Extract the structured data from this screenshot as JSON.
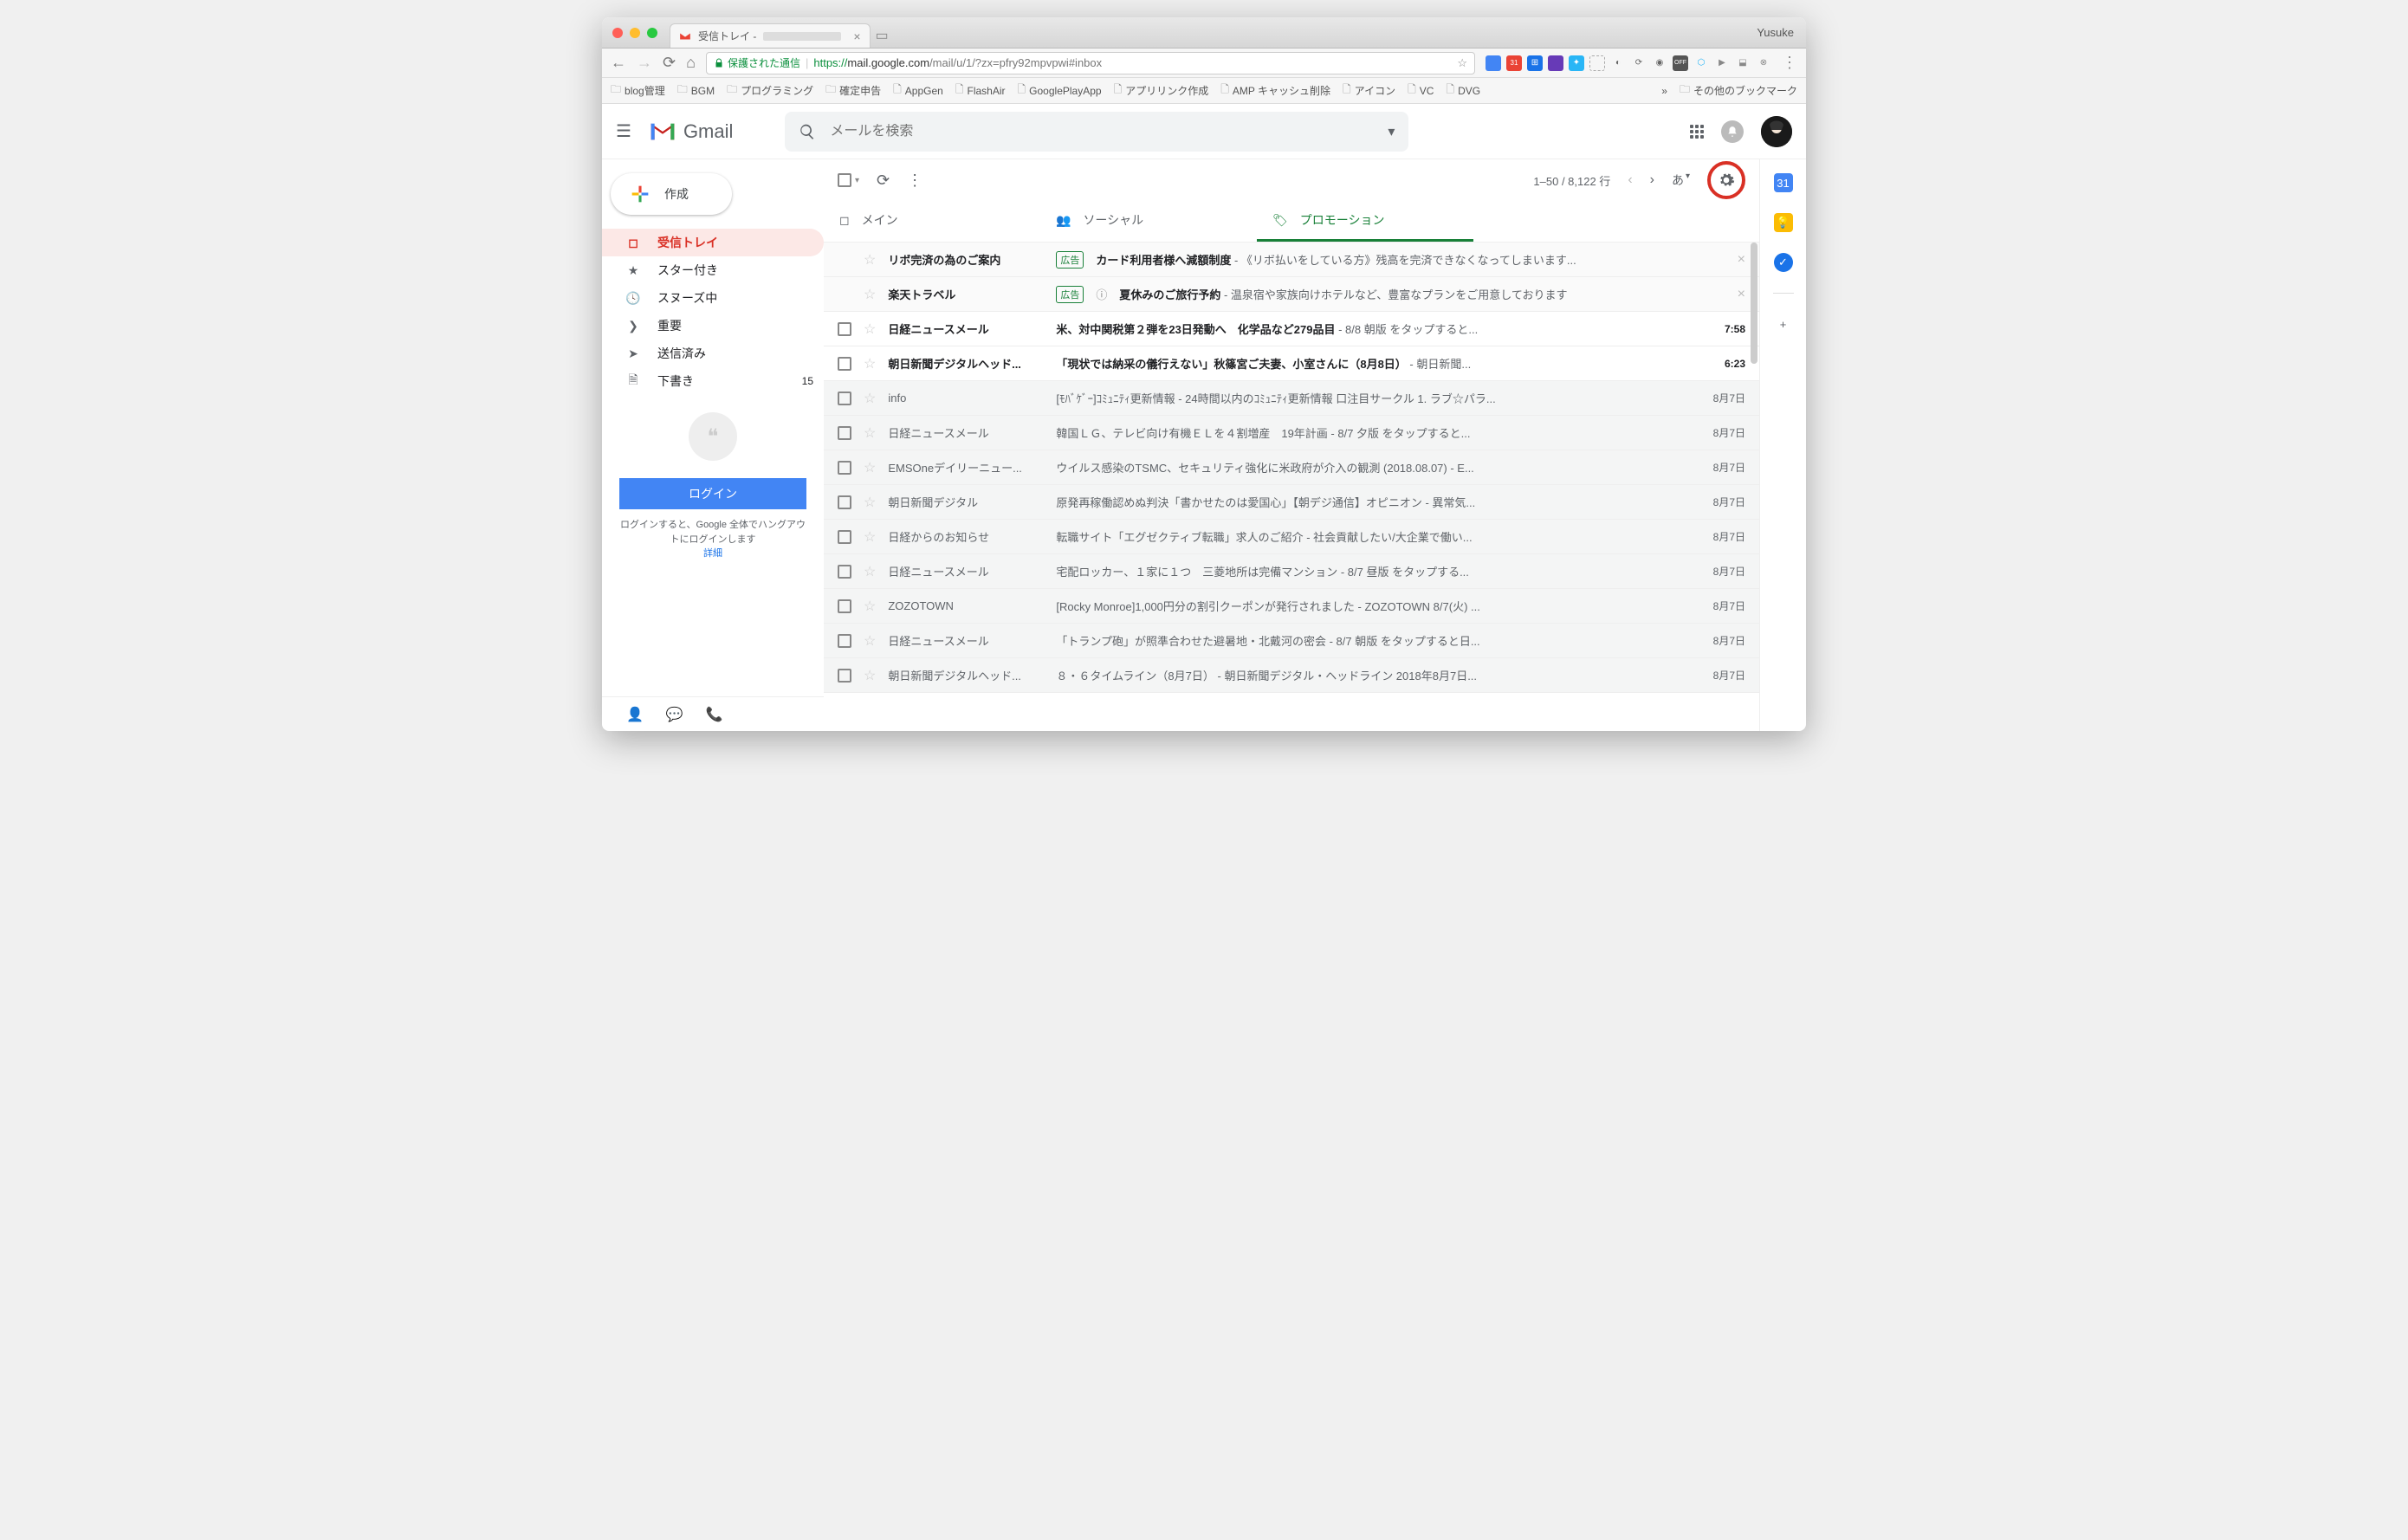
{
  "browser": {
    "tab_title": "受信トレイ -",
    "profile_name": "Yusuke",
    "secure_label": "保護された通信",
    "url_prefix": "https://",
    "url_host": "mail.google.com",
    "url_path": "/mail/u/1/?zx=pfry92mpvpwi#inbox"
  },
  "bookmarks": [
    {
      "label": "blog管理",
      "type": "folder"
    },
    {
      "label": "BGM",
      "type": "folder"
    },
    {
      "label": "プログラミング",
      "type": "folder"
    },
    {
      "label": "確定申告",
      "type": "folder"
    },
    {
      "label": "AppGen",
      "type": "page"
    },
    {
      "label": "FlashAir",
      "type": "page"
    },
    {
      "label": "GooglePlayApp",
      "type": "page"
    },
    {
      "label": "アプリリンク作成",
      "type": "page"
    },
    {
      "label": "AMP キャッシュ削除",
      "type": "page"
    },
    {
      "label": "アイコン",
      "type": "page"
    },
    {
      "label": "VC",
      "type": "page"
    },
    {
      "label": "DVG",
      "type": "page"
    }
  ],
  "bookmarks_more": "»",
  "other_bookmarks": "その他のブックマーク",
  "gmail": {
    "brand": "Gmail",
    "search_placeholder": "メールを検索",
    "compose": "作成",
    "nav": [
      {
        "label": "受信トレイ",
        "icon": "inbox",
        "active": true
      },
      {
        "label": "スター付き",
        "icon": "star"
      },
      {
        "label": "スヌーズ中",
        "icon": "clock"
      },
      {
        "label": "重要",
        "icon": "important"
      },
      {
        "label": "送信済み",
        "icon": "send"
      },
      {
        "label": "下書き",
        "icon": "draft",
        "count": "15"
      }
    ],
    "hangouts": {
      "login_button": "ログイン",
      "message": "ログインすると、Google 全体でハングアウトにログインします",
      "detail": "詳細"
    },
    "toolbar": {
      "pagination": "1–50 / 8,122 行",
      "lang": "あ"
    },
    "tabs": [
      {
        "label": "メイン",
        "icon": "inbox"
      },
      {
        "label": "ソーシャル",
        "icon": "people"
      },
      {
        "label": "プロモーション",
        "icon": "tag",
        "active": true
      }
    ],
    "ads": [
      {
        "sender": "リボ完済の為のご案内",
        "tag": "広告",
        "subject": "カード利用者様へ減額制度",
        "snippet": " - 《リボ払いをしている方》残高を完済できなくなってしまいます..."
      },
      {
        "sender": "楽天トラベル",
        "tag": "広告",
        "info": true,
        "subject": "夏休みのご旅行予約",
        "snippet": " - 温泉宿や家族向けホテルなど、豊富なプランをご用意しております"
      }
    ],
    "emails": [
      {
        "sender": "日経ニュースメール",
        "subject": "米、対中関税第２弾を23日発動へ　化学品など279品目",
        "snippet": " - 8/8 朝版 をタップすると...",
        "date": "7:58",
        "unread": true
      },
      {
        "sender": "朝日新聞デジタルヘッド...",
        "subject": "「現状では納采の儀行えない」秋篠宮ご夫妻、小室さんに（8月8日）",
        "snippet": " - 朝日新聞...",
        "date": "6:23",
        "unread": true
      },
      {
        "sender": "info",
        "subject": "[ﾓﾊﾞｹﾞｰ]ｺﾐｭﾆﾃｨ更新情報",
        "snippet": " - 24時間以内のｺﾐｭﾆﾃｨ更新情報 口注目サークル 1. ラブ☆パラ...",
        "date": "8月7日"
      },
      {
        "sender": "日経ニュースメール",
        "subject": "韓国ＬＧ、テレビ向け有機ＥＬを４割増産　19年計画",
        "snippet": " - 8/7 夕版 をタップすると...",
        "date": "8月7日"
      },
      {
        "sender": "EMSOneデイリーニュー...",
        "subject": "ウイルス感染のTSMC、セキュリティ強化に米政府が介入の観測 (2018.08.07)",
        "snippet": " - E...",
        "date": "8月7日"
      },
      {
        "sender": "朝日新聞デジタル",
        "subject": "原発再稼働認めぬ判決「書かせたのは愛国心」【朝デジ通信】オピニオン",
        "snippet": " - 異常気...",
        "date": "8月7日"
      },
      {
        "sender": "日経からのお知らせ",
        "subject": "転職サイト「エグゼクティブ転職」求人のご紹介",
        "snippet": " - 社会貢献したい/大企業で働い...",
        "date": "8月7日"
      },
      {
        "sender": "日経ニュースメール",
        "subject": "宅配ロッカー、１家に１つ　三菱地所は完備マンション",
        "snippet": " - 8/7 昼版 をタップする...",
        "date": "8月7日"
      },
      {
        "sender": "ZOZOTOWN",
        "subject": "[Rocky Monroe]1,000円分の割引クーポンが発行されました",
        "snippet": " - ZOZOTOWN 8/7(火) ...",
        "date": "8月7日"
      },
      {
        "sender": "日経ニュースメール",
        "subject": "「トランプ砲」が照準合わせた避暑地・北戴河の密会",
        "snippet": " - 8/7 朝版 をタップすると日...",
        "date": "8月7日"
      },
      {
        "sender": "朝日新聞デジタルヘッド...",
        "subject": "８・６タイムライン（8月7日）",
        "snippet": " - 朝日新聞デジタル・ヘッドライン 2018年8月7日...",
        "date": "8月7日"
      }
    ]
  }
}
